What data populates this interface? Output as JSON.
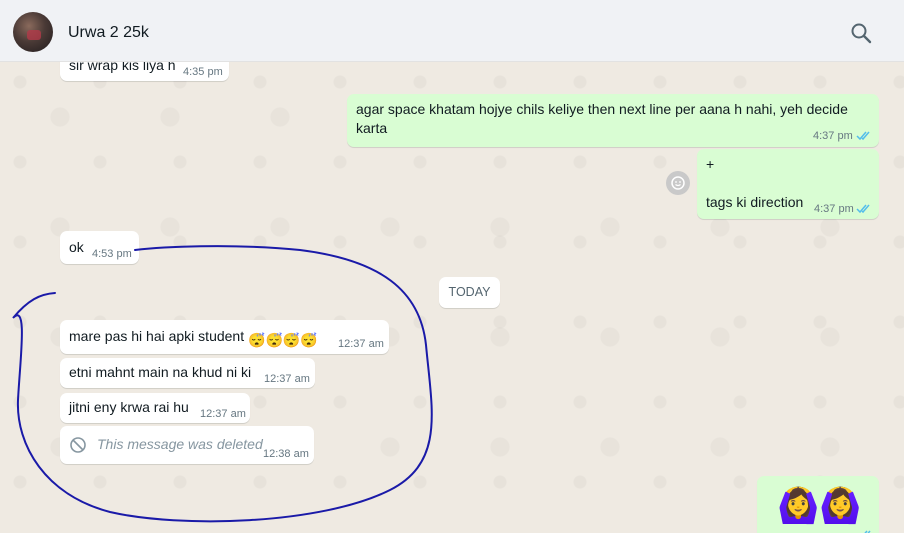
{
  "header": {
    "contact_name": "Urwa 2 25k",
    "avatar_icon": "contact-avatar",
    "search_icon": "search-icon"
  },
  "messages": [
    {
      "dir": "in",
      "text": "sir wrap kis liya h",
      "time": "4:35 pm"
    },
    {
      "dir": "out",
      "lines": [
        "agar space khatam hojye chils keliye then next line per aana h nahi, yeh decide",
        "karta"
      ],
      "time": "4:37 pm",
      "status": "read"
    },
    {
      "dir": "out",
      "lines": [
        "+",
        "",
        "tags ki direction"
      ],
      "time": "4:37 pm",
      "status": "read"
    },
    {
      "dir": "in",
      "text": "ok",
      "time": "4:53 pm"
    },
    {
      "dir": "in",
      "text": "mare pas hi hai apki student",
      "emojis": [
        "😴",
        "😴",
        "😴",
        "😴"
      ],
      "time": "12:37 am"
    },
    {
      "dir": "in",
      "text": "etni mahnt main na khud ni ki",
      "time": "12:37 am"
    },
    {
      "dir": "in",
      "text": "jitni eny krwa rai hu",
      "time": "12:37 am"
    },
    {
      "dir": "in",
      "text": "This message was deleted",
      "time": "12:38 am",
      "deleted": true
    },
    {
      "dir": "out",
      "emojis": [
        "🙆‍♀️",
        "🙆‍♀️"
      ],
      "time": "",
      "status": "read"
    }
  ],
  "date_divider": "TODAY",
  "colors": {
    "incoming": "#ffffff",
    "outgoing": "#d9fdd3",
    "read_ticks": "#53bdeb",
    "annotation_stroke": "#1a1aa8"
  }
}
